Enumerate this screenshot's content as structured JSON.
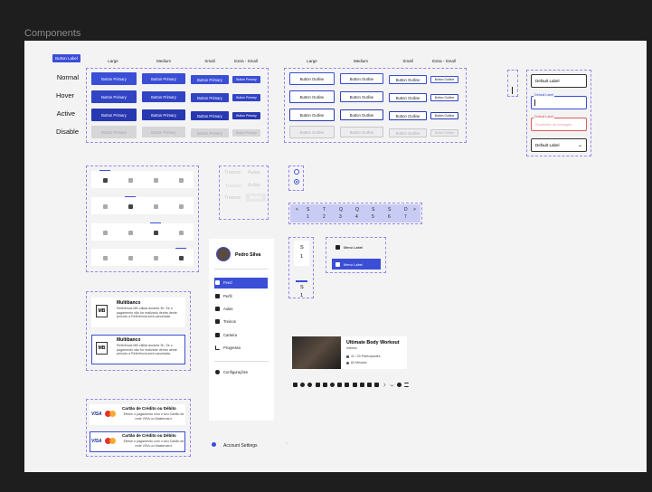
{
  "frame_title": "Components",
  "button_label_tag": "Button Label",
  "size_headers": [
    "Large",
    "Medium",
    "Small",
    "Extra - Small"
  ],
  "states": [
    "Normal",
    "Hover",
    "Active",
    "Disable"
  ],
  "primary_label": "Button Primary",
  "outline_label": "Button Outline",
  "inputs": {
    "default_label": "Default Label",
    "focused_label": "Default Label",
    "error_label": "Default Label",
    "error_placeholder": "Placeholder da mensagem",
    "select_label": "Default Label"
  },
  "toggle_labels": {
    "row1": [
      "Treinos",
      "Aulas"
    ],
    "row2": [
      "Treinos",
      "Aulas"
    ],
    "row3": [
      "Treinos",
      "Aulas"
    ]
  },
  "calendar": {
    "days": [
      "S",
      "T",
      "Q",
      "Q",
      "S",
      "S",
      "D"
    ],
    "dates": [
      "1",
      "2",
      "3",
      "4",
      "5",
      "6",
      "7"
    ],
    "prev": "<",
    "next": ">"
  },
  "vertical_day": {
    "letter": "S",
    "num": "1"
  },
  "menu": {
    "item1": "Menu Label",
    "item2": "Menu Label"
  },
  "profile": {
    "name": "Pedro Silva"
  },
  "sidebar": {
    "items": [
      "Feed",
      "Perfil",
      "Aulas",
      "Treinos",
      "Carteira",
      "Progresso"
    ],
    "settings": "Configurações"
  },
  "account_settings": "Account Settings",
  "payment_mb": {
    "title": "Multibanco",
    "desc": "Referência MB válida durante 3h. Se o pagamento não for realizado dentro deste período a Referência será cancelada.",
    "logo": "MB"
  },
  "payment_card": {
    "title": "Cartão de Crédito ou Débito",
    "desc": "Efetue o pagamento com o seu Cartão de rede VISA ou Mastercard.",
    "visa": "VISA"
  },
  "workout": {
    "title": "Ultimate Body Workout",
    "subtitle": "Intenso",
    "participants": "11 / 20 Participantes",
    "duration": "60 Minutos"
  },
  "colors": {
    "primary": "#3a4ed6",
    "dash": "#9a86e8",
    "error": "#e05a5a"
  }
}
